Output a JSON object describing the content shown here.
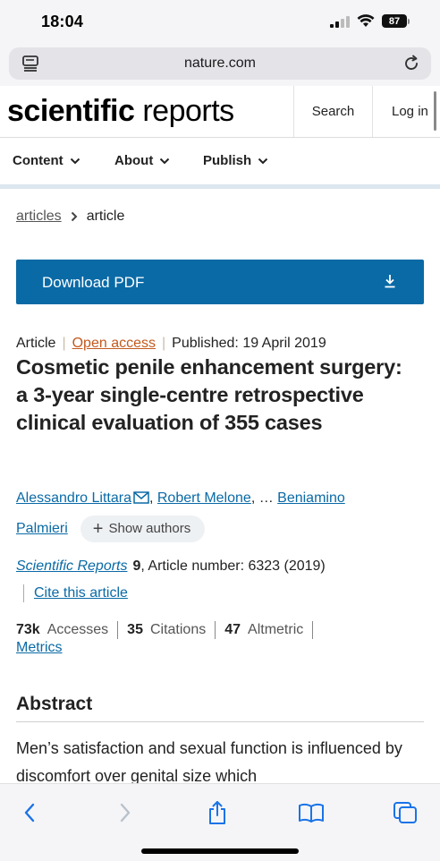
{
  "status": {
    "time": "18:04",
    "battery": "87"
  },
  "browser": {
    "url": "nature.com"
  },
  "header": {
    "logo_bold": "scientific",
    "logo_light": " reports",
    "search": "Search",
    "login": "Log in"
  },
  "nav": {
    "items": [
      "Content",
      "About",
      "Publish"
    ]
  },
  "breadcrumb": {
    "link": "articles",
    "current": "article"
  },
  "download": {
    "label": "Download PDF"
  },
  "meta": {
    "type": "Article",
    "access": "Open access",
    "published": "Published: 19 April 2019"
  },
  "title": "Cosmetic penile enhancement surgery: a 3-year single-centre retrospective clinical evaluation of 355 cases",
  "authors": {
    "first": "Alessandro Littara",
    "second": "Robert Melone",
    "ellipsis": ", …",
    "last_part1": "Beniamino",
    "last_part2": "Palmieri",
    "show_authors": "Show authors"
  },
  "journal": {
    "name": "Scientific Reports",
    "volume": "9",
    "article_number": ", Article number: 6323 (2019)",
    "cite": "Cite this article"
  },
  "metrics": {
    "accesses_value": "73k",
    "accesses_label": "Accesses",
    "citations_value": "35",
    "citations_label": "Citations",
    "altmetric_value": "47",
    "altmetric_label": "Altmetric",
    "link": "Metrics"
  },
  "abstract": {
    "heading": "Abstract",
    "text": "Men’s satisfaction and sexual function is influenced by discomfort over genital size which"
  },
  "colors": {
    "accent": "#0a6aa6",
    "open_access": "#c35a1e"
  }
}
